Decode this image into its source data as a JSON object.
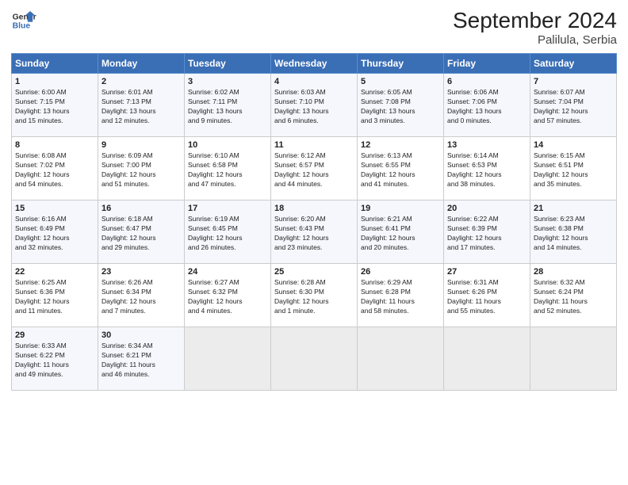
{
  "logo": {
    "line1": "General",
    "line2": "Blue"
  },
  "title": "September 2024",
  "subtitle": "Palilula, Serbia",
  "headers": [
    "Sunday",
    "Monday",
    "Tuesday",
    "Wednesday",
    "Thursday",
    "Friday",
    "Saturday"
  ],
  "weeks": [
    [
      {
        "day": "1",
        "info": "Sunrise: 6:00 AM\nSunset: 7:15 PM\nDaylight: 13 hours\nand 15 minutes."
      },
      {
        "day": "2",
        "info": "Sunrise: 6:01 AM\nSunset: 7:13 PM\nDaylight: 13 hours\nand 12 minutes."
      },
      {
        "day": "3",
        "info": "Sunrise: 6:02 AM\nSunset: 7:11 PM\nDaylight: 13 hours\nand 9 minutes."
      },
      {
        "day": "4",
        "info": "Sunrise: 6:03 AM\nSunset: 7:10 PM\nDaylight: 13 hours\nand 6 minutes."
      },
      {
        "day": "5",
        "info": "Sunrise: 6:05 AM\nSunset: 7:08 PM\nDaylight: 13 hours\nand 3 minutes."
      },
      {
        "day": "6",
        "info": "Sunrise: 6:06 AM\nSunset: 7:06 PM\nDaylight: 13 hours\nand 0 minutes."
      },
      {
        "day": "7",
        "info": "Sunrise: 6:07 AM\nSunset: 7:04 PM\nDaylight: 12 hours\nand 57 minutes."
      }
    ],
    [
      {
        "day": "8",
        "info": "Sunrise: 6:08 AM\nSunset: 7:02 PM\nDaylight: 12 hours\nand 54 minutes."
      },
      {
        "day": "9",
        "info": "Sunrise: 6:09 AM\nSunset: 7:00 PM\nDaylight: 12 hours\nand 51 minutes."
      },
      {
        "day": "10",
        "info": "Sunrise: 6:10 AM\nSunset: 6:58 PM\nDaylight: 12 hours\nand 47 minutes."
      },
      {
        "day": "11",
        "info": "Sunrise: 6:12 AM\nSunset: 6:57 PM\nDaylight: 12 hours\nand 44 minutes."
      },
      {
        "day": "12",
        "info": "Sunrise: 6:13 AM\nSunset: 6:55 PM\nDaylight: 12 hours\nand 41 minutes."
      },
      {
        "day": "13",
        "info": "Sunrise: 6:14 AM\nSunset: 6:53 PM\nDaylight: 12 hours\nand 38 minutes."
      },
      {
        "day": "14",
        "info": "Sunrise: 6:15 AM\nSunset: 6:51 PM\nDaylight: 12 hours\nand 35 minutes."
      }
    ],
    [
      {
        "day": "15",
        "info": "Sunrise: 6:16 AM\nSunset: 6:49 PM\nDaylight: 12 hours\nand 32 minutes."
      },
      {
        "day": "16",
        "info": "Sunrise: 6:18 AM\nSunset: 6:47 PM\nDaylight: 12 hours\nand 29 minutes."
      },
      {
        "day": "17",
        "info": "Sunrise: 6:19 AM\nSunset: 6:45 PM\nDaylight: 12 hours\nand 26 minutes."
      },
      {
        "day": "18",
        "info": "Sunrise: 6:20 AM\nSunset: 6:43 PM\nDaylight: 12 hours\nand 23 minutes."
      },
      {
        "day": "19",
        "info": "Sunrise: 6:21 AM\nSunset: 6:41 PM\nDaylight: 12 hours\nand 20 minutes."
      },
      {
        "day": "20",
        "info": "Sunrise: 6:22 AM\nSunset: 6:39 PM\nDaylight: 12 hours\nand 17 minutes."
      },
      {
        "day": "21",
        "info": "Sunrise: 6:23 AM\nSunset: 6:38 PM\nDaylight: 12 hours\nand 14 minutes."
      }
    ],
    [
      {
        "day": "22",
        "info": "Sunrise: 6:25 AM\nSunset: 6:36 PM\nDaylight: 12 hours\nand 11 minutes."
      },
      {
        "day": "23",
        "info": "Sunrise: 6:26 AM\nSunset: 6:34 PM\nDaylight: 12 hours\nand 7 minutes."
      },
      {
        "day": "24",
        "info": "Sunrise: 6:27 AM\nSunset: 6:32 PM\nDaylight: 12 hours\nand 4 minutes."
      },
      {
        "day": "25",
        "info": "Sunrise: 6:28 AM\nSunset: 6:30 PM\nDaylight: 12 hours\nand 1 minute."
      },
      {
        "day": "26",
        "info": "Sunrise: 6:29 AM\nSunset: 6:28 PM\nDaylight: 11 hours\nand 58 minutes."
      },
      {
        "day": "27",
        "info": "Sunrise: 6:31 AM\nSunset: 6:26 PM\nDaylight: 11 hours\nand 55 minutes."
      },
      {
        "day": "28",
        "info": "Sunrise: 6:32 AM\nSunset: 6:24 PM\nDaylight: 11 hours\nand 52 minutes."
      }
    ],
    [
      {
        "day": "29",
        "info": "Sunrise: 6:33 AM\nSunset: 6:22 PM\nDaylight: 11 hours\nand 49 minutes."
      },
      {
        "day": "30",
        "info": "Sunrise: 6:34 AM\nSunset: 6:21 PM\nDaylight: 11 hours\nand 46 minutes."
      },
      null,
      null,
      null,
      null,
      null
    ]
  ]
}
